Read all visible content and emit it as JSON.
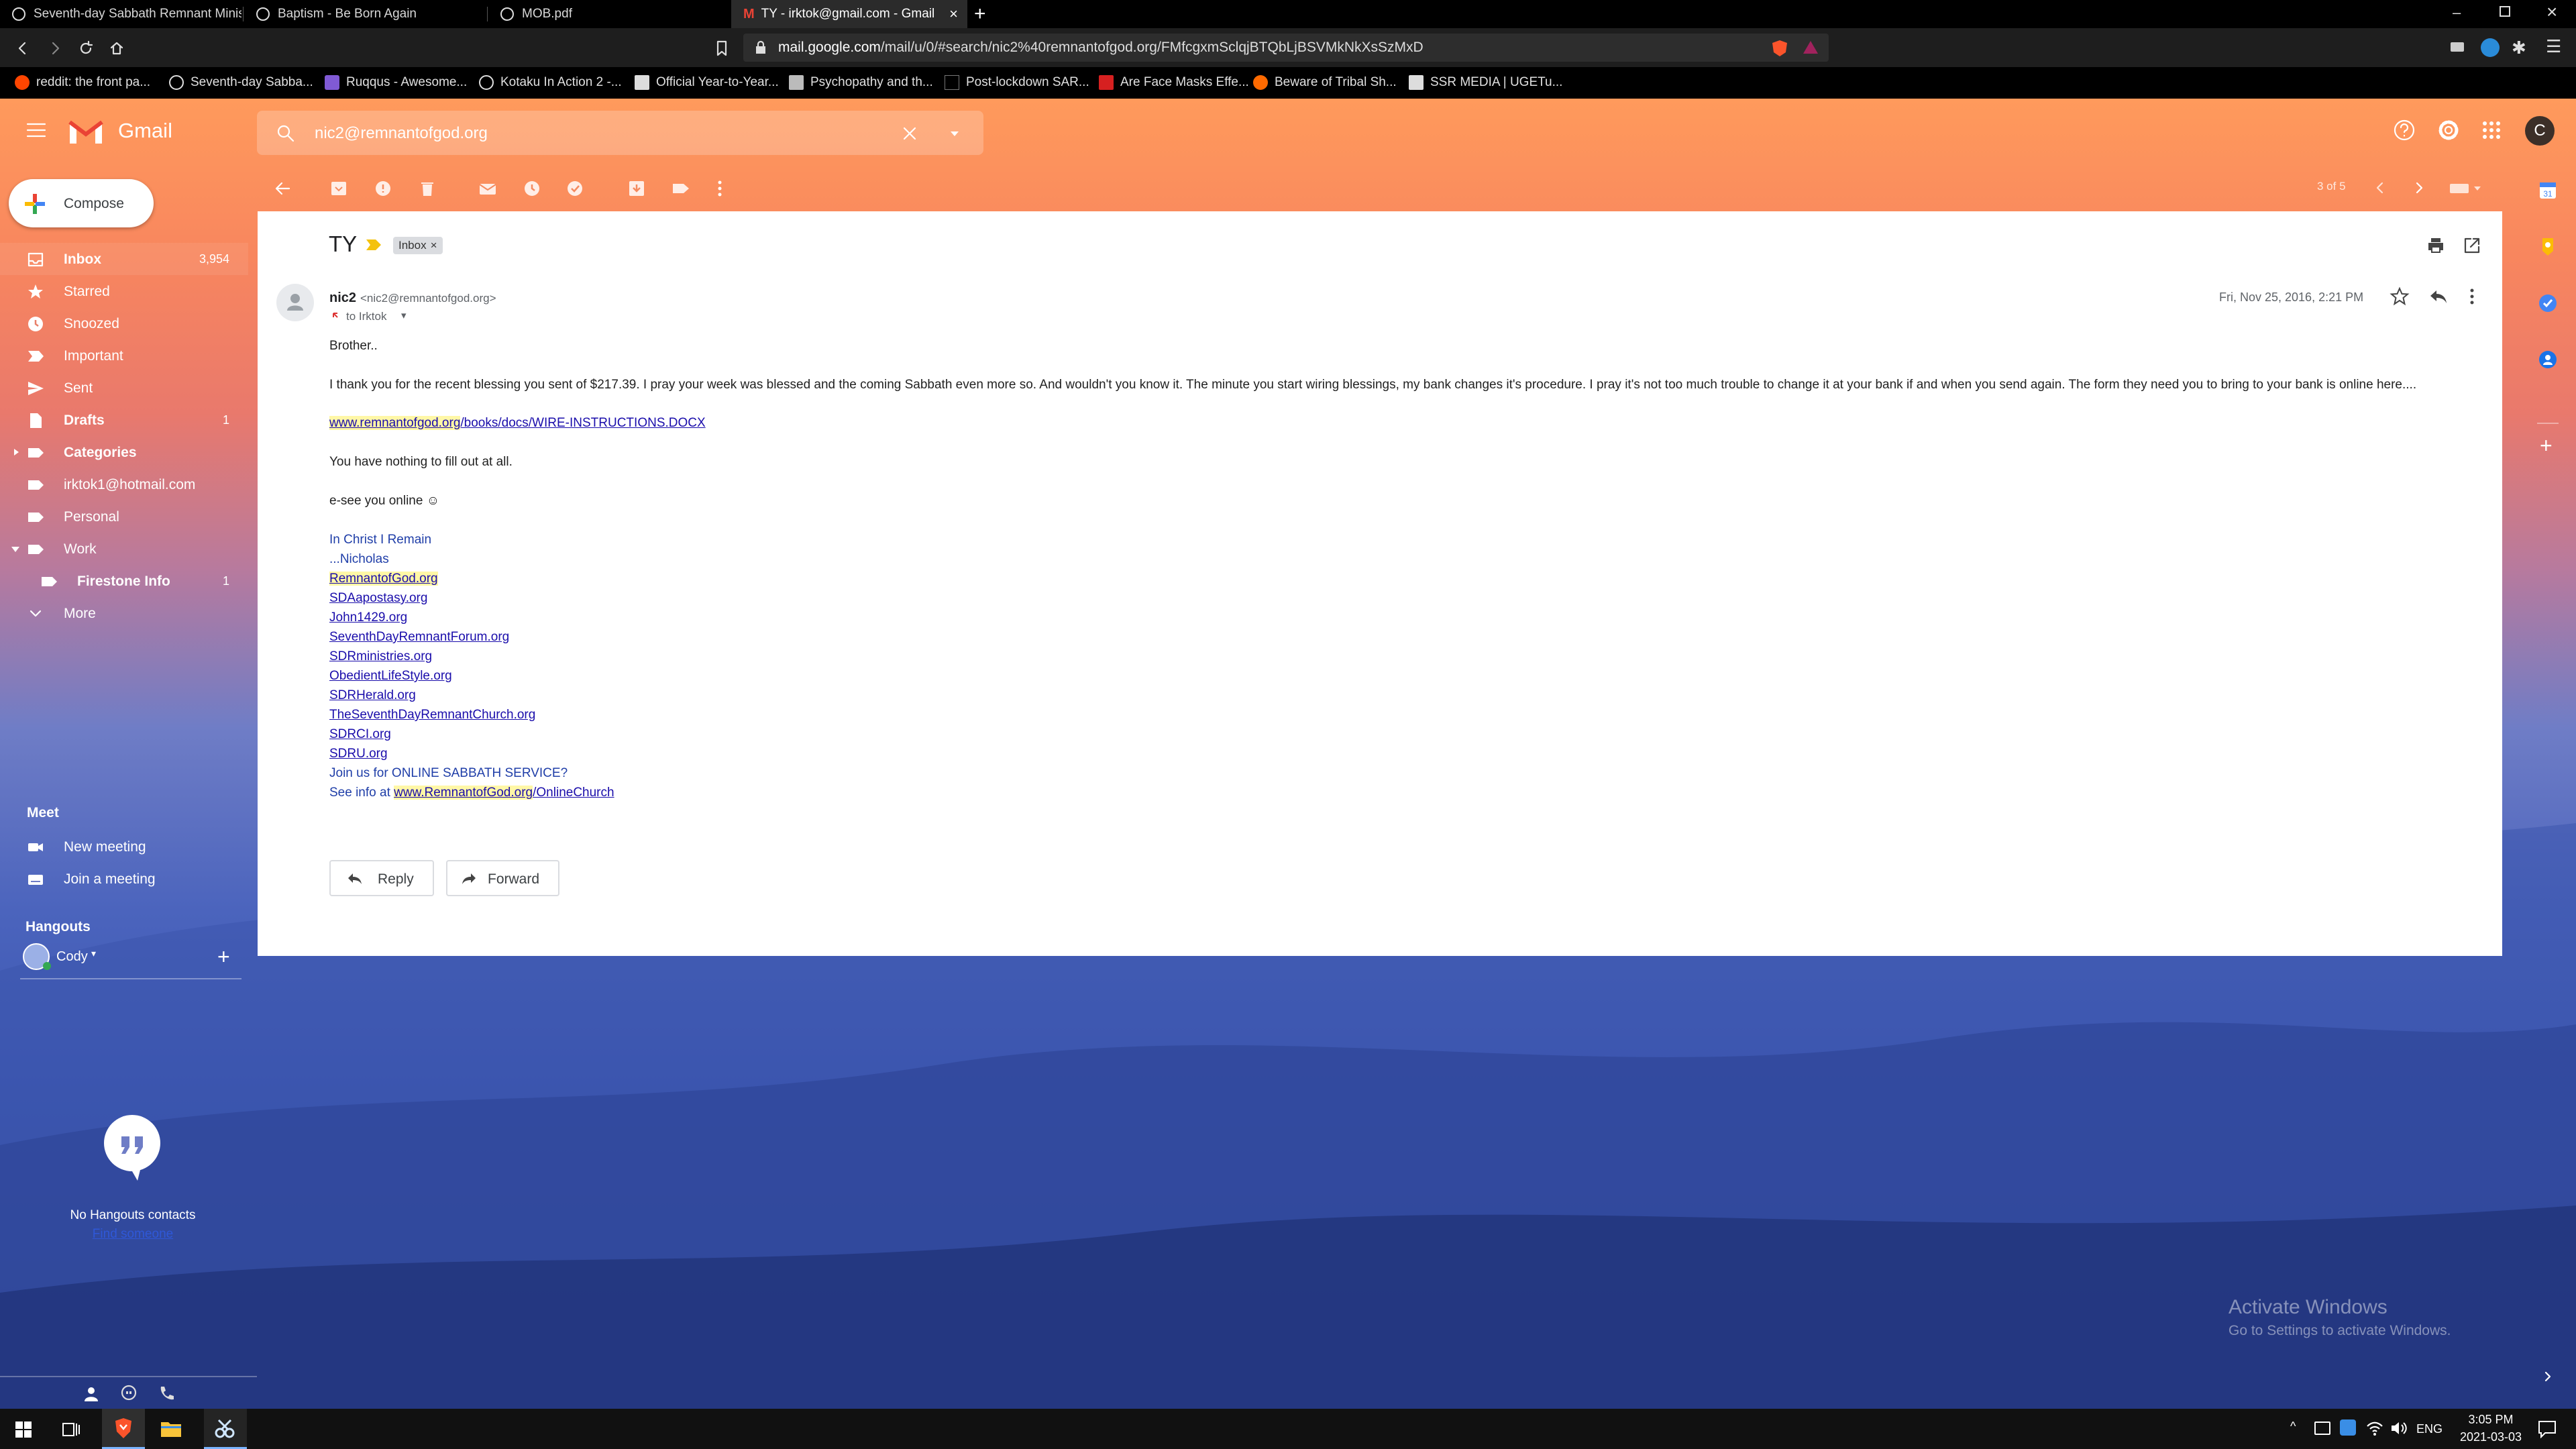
{
  "browser": {
    "tabs": [
      {
        "title": "Seventh-day Sabbath Remnant Minist"
      },
      {
        "title": "Baptism - Be Born Again"
      },
      {
        "title": "MOB.pdf"
      },
      {
        "title": "TY - irktok@gmail.com - Gmail",
        "active": true
      }
    ],
    "url_host": "mail.google.com",
    "url_path": "/mail/u/0/#search/nic2%40remnantofgod.org/FMfcgxmSclqjBTQbLjBSVMkNkXsSzMxD",
    "bookmarks": [
      "reddit: the front pa...",
      "Seventh-day Sabba...",
      "Ruqqus - Awesome...",
      "Kotaku In Action 2 -...",
      "Official Year-to-Year...",
      "Psychopathy and th...",
      "Post-lockdown SAR...",
      "Are Face Masks Effe...",
      "Beware of Tribal Sh...",
      "SSR MEDIA | UGETu..."
    ]
  },
  "gmail": {
    "logo": "Gmail",
    "search_value": "nic2@remnantofgod.org",
    "avatar_letter": "C",
    "compose_label": "Compose",
    "pagination": "3 of 5",
    "nav": [
      {
        "label": "Inbox",
        "count": "3,954",
        "bold": true,
        "icon": "inbox-icon"
      },
      {
        "label": "Starred",
        "count": "",
        "icon": "star-icon"
      },
      {
        "label": "Snoozed",
        "count": "",
        "icon": "clock-icon"
      },
      {
        "label": "Important",
        "count": "",
        "icon": "important-icon"
      },
      {
        "label": "Sent",
        "count": "",
        "icon": "send-icon"
      },
      {
        "label": "Drafts",
        "count": "1",
        "bold": true,
        "icon": "draft-icon"
      },
      {
        "label": "Categories",
        "count": "",
        "bold": true,
        "icon": "label-icon"
      },
      {
        "label": "irktok1@hotmail.com",
        "count": "",
        "icon": "label-icon"
      },
      {
        "label": "Personal",
        "count": "",
        "icon": "label-icon"
      },
      {
        "label": "Work",
        "count": "",
        "icon": "label-icon"
      },
      {
        "label": "Firestone Info",
        "count": "1",
        "bold": true,
        "icon": "label-icon"
      },
      {
        "label": "More",
        "count": "",
        "icon": "chevron-down-icon"
      }
    ],
    "meet": {
      "title": "Meet",
      "new_meeting": "New meeting",
      "join_meeting": "Join a meeting"
    },
    "hangouts": {
      "title": "Hangouts",
      "user": "Cody",
      "empty": "No Hangouts contacts",
      "find": "Find someone"
    }
  },
  "email": {
    "subject": "TY",
    "label": "Inbox",
    "sender_name": "nic2",
    "sender_email": "<nic2@remnantofgod.org>",
    "to": "to Irktok",
    "date": "Fri, Nov 25, 2016, 2:21 PM",
    "greeting": "Brother..",
    "paragraph": "I thank you for the recent blessing you sent of $217.39. I pray your week was blessed and the coming Sabbath even more so. And wouldn't you know it. The minute you start wiring blessings, my bank changes it's procedure. I pray it's not too much trouble to change it at your bank if and when you send again. The form they need you to bring to your bank is online here....",
    "link_host": "www.remnantofgod.org",
    "link_path": "/books/docs/WIRE-INSTRUCTIONS.DOCX",
    "line_fill": "You have nothing to fill out at all.",
    "line_see": "e-see you online ☺",
    "sig_1": "In Christ I Remain",
    "sig_2": "...Nicholas",
    "links": [
      "RemnantofGod.org",
      "SDAapostasy.org",
      "John1429.org",
      "SeventhDayRemnantForum.org",
      "SDRministries.org",
      "ObedientLifeStyle.org",
      "SDRHerald.org",
      "TheSeventhDayRemnantChurch.org",
      "SDRCI.org",
      "SDRU.org"
    ],
    "join": "Join us for ONLINE SABBATH SERVICE?",
    "see_info": "See info at ",
    "see_link_host": "www.RemnantofGod.org",
    "see_link_path": "/OnlineChurch",
    "reply": "Reply",
    "forward": "Forward"
  },
  "windows": {
    "activate_title": "Activate Windows",
    "activate_sub": "Go to Settings to activate Windows.",
    "lang": "ENG",
    "time": "3:05 PM",
    "date": "2021-03-03"
  }
}
